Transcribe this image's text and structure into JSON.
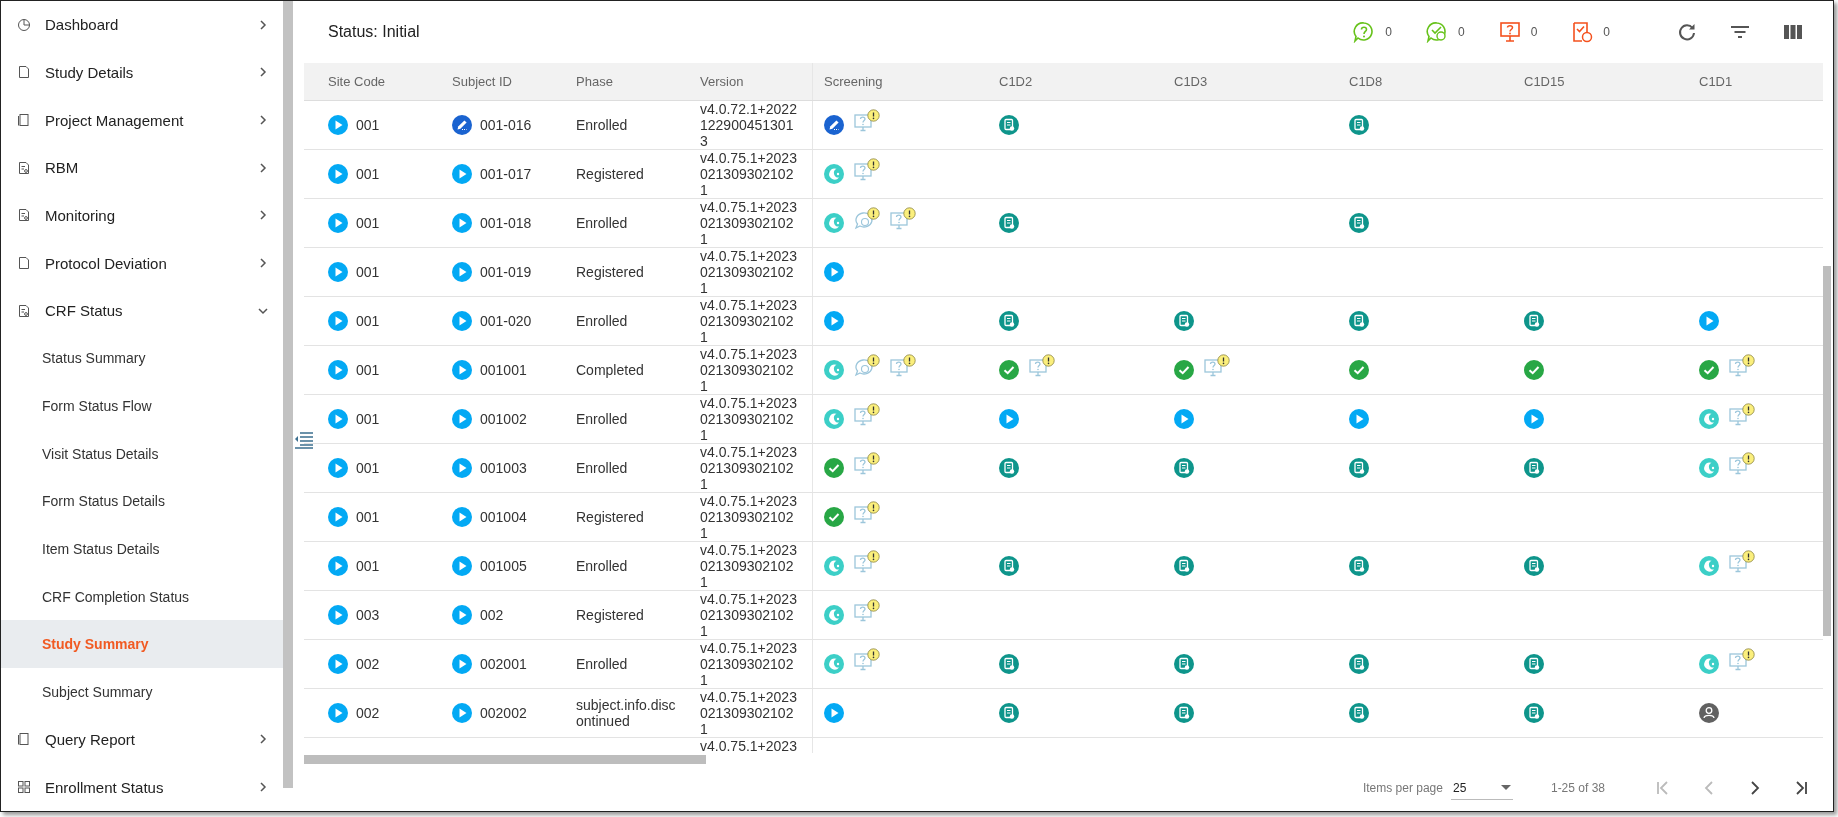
{
  "sidebar": {
    "items": [
      {
        "label": "Dashboard",
        "expanded": false
      },
      {
        "label": "Study Details",
        "expanded": false
      },
      {
        "label": "Project Management",
        "expanded": false
      },
      {
        "label": "RBM",
        "expanded": false
      },
      {
        "label": "Monitoring",
        "expanded": false
      },
      {
        "label": "Protocol Deviation",
        "expanded": false
      },
      {
        "label": "CRF Status",
        "expanded": true,
        "children": [
          {
            "label": "Status Summary",
            "selected": false
          },
          {
            "label": "Form Status Flow",
            "selected": false
          },
          {
            "label": "Visit Status Details",
            "selected": false
          },
          {
            "label": "Form Status Details",
            "selected": false
          },
          {
            "label": "Item Status Details",
            "selected": false
          },
          {
            "label": "CRF Completion Status",
            "selected": false
          },
          {
            "label": "Study Summary",
            "selected": true
          },
          {
            "label": "Subject Summary",
            "selected": false
          }
        ]
      },
      {
        "label": "Query Report",
        "expanded": false
      },
      {
        "label": "Enrollment Status",
        "expanded": false
      }
    ]
  },
  "header": {
    "title": "Status: Initial",
    "counters": [
      {
        "count": "0"
      },
      {
        "count": "0"
      },
      {
        "count": "0"
      },
      {
        "count": "0"
      }
    ]
  },
  "table": {
    "columns": [
      "Site Code",
      "Subject ID",
      "Phase",
      "Version"
    ],
    "visit_columns": [
      "Screening",
      "C1D2",
      "C1D3",
      "C1D8",
      "C1D15",
      "C1D1"
    ],
    "rows": [
      {
        "site_code": "001",
        "site_icon": {
          "kind": "play"
        },
        "subject_id": "001-016",
        "subject_icon": {
          "kind": "edit"
        },
        "phase": "Enrolled",
        "version": "v4.0.72.1+20221229004513013",
        "visits": [
          [
            {
              "kind": "edit"
            },
            {
              "kind": "query"
            }
          ],
          [
            {
              "kind": "form"
            }
          ],
          [
            {
              "kind": "empty"
            }
          ],
          [
            {
              "kind": "form"
            }
          ]
        ]
      },
      {
        "site_code": "001",
        "site_icon": {
          "kind": "play"
        },
        "subject_id": "001-017",
        "subject_icon": {
          "kind": "play"
        },
        "phase": "Registered",
        "version": "v4.0.75.1+20230213093021021",
        "visits": [
          [
            {
              "kind": "partial"
            },
            {
              "kind": "query"
            }
          ]
        ]
      },
      {
        "site_code": "001",
        "site_icon": {
          "kind": "play"
        },
        "subject_id": "001-018",
        "subject_icon": {
          "kind": "play"
        },
        "phase": "Enrolled",
        "version": "v4.0.75.1+20230213093021021",
        "visits": [
          [
            {
              "kind": "partial"
            },
            {
              "kind": "comment"
            },
            {
              "kind": "query"
            }
          ],
          [
            {
              "kind": "form"
            }
          ],
          [
            {
              "kind": "empty"
            }
          ],
          [
            {
              "kind": "form"
            }
          ]
        ]
      },
      {
        "site_code": "001",
        "site_icon": {
          "kind": "play"
        },
        "subject_id": "001-019",
        "subject_icon": {
          "kind": "play"
        },
        "phase": "Registered",
        "version": "v4.0.75.1+20230213093021021",
        "visits": [
          [
            {
              "kind": "play"
            }
          ]
        ]
      },
      {
        "site_code": "001",
        "site_icon": {
          "kind": "play"
        },
        "subject_id": "001-020",
        "subject_icon": {
          "kind": "play"
        },
        "phase": "Enrolled",
        "version": "v4.0.75.1+20230213093021021",
        "visits": [
          [
            {
              "kind": "play"
            }
          ],
          [
            {
              "kind": "form"
            }
          ],
          [
            {
              "kind": "form"
            }
          ],
          [
            {
              "kind": "form"
            }
          ],
          [
            {
              "kind": "form"
            }
          ],
          [
            {
              "kind": "play"
            }
          ]
        ]
      },
      {
        "site_code": "001",
        "site_icon": {
          "kind": "play"
        },
        "subject_id": "001001",
        "subject_icon": {
          "kind": "play"
        },
        "phase": "Completed",
        "version": "v4.0.75.1+20230213093021021",
        "visits": [
          [
            {
              "kind": "partial"
            },
            {
              "kind": "comment"
            },
            {
              "kind": "query"
            }
          ],
          [
            {
              "kind": "done"
            },
            {
              "kind": "query"
            }
          ],
          [
            {
              "kind": "done"
            },
            {
              "kind": "query"
            }
          ],
          [
            {
              "kind": "done"
            }
          ],
          [
            {
              "kind": "done"
            }
          ],
          [
            {
              "kind": "done"
            },
            {
              "kind": "query"
            }
          ]
        ]
      },
      {
        "site_code": "001",
        "site_icon": {
          "kind": "play"
        },
        "subject_id": "001002",
        "subject_icon": {
          "kind": "play"
        },
        "phase": "Enrolled",
        "version": "v4.0.75.1+20230213093021021",
        "visits": [
          [
            {
              "kind": "partial"
            },
            {
              "kind": "query"
            }
          ],
          [
            {
              "kind": "play"
            }
          ],
          [
            {
              "kind": "play"
            }
          ],
          [
            {
              "kind": "play"
            }
          ],
          [
            {
              "kind": "play"
            }
          ],
          [
            {
              "kind": "partial"
            },
            {
              "kind": "query"
            }
          ]
        ]
      },
      {
        "site_code": "001",
        "site_icon": {
          "kind": "play"
        },
        "subject_id": "001003",
        "subject_icon": {
          "kind": "play"
        },
        "phase": "Enrolled",
        "version": "v4.0.75.1+20230213093021021",
        "visits": [
          [
            {
              "kind": "done"
            },
            {
              "kind": "query"
            }
          ],
          [
            {
              "kind": "form"
            }
          ],
          [
            {
              "kind": "form"
            }
          ],
          [
            {
              "kind": "form"
            }
          ],
          [
            {
              "kind": "form"
            }
          ],
          [
            {
              "kind": "partial"
            },
            {
              "kind": "query"
            }
          ]
        ]
      },
      {
        "site_code": "001",
        "site_icon": {
          "kind": "play"
        },
        "subject_id": "001004",
        "subject_icon": {
          "kind": "play"
        },
        "phase": "Registered",
        "version": "v4.0.75.1+20230213093021021",
        "visits": [
          [
            {
              "kind": "done"
            },
            {
              "kind": "query"
            }
          ]
        ]
      },
      {
        "site_code": "001",
        "site_icon": {
          "kind": "play"
        },
        "subject_id": "001005",
        "subject_icon": {
          "kind": "play"
        },
        "phase": "Enrolled",
        "version": "v4.0.75.1+20230213093021021",
        "visits": [
          [
            {
              "kind": "partial"
            },
            {
              "kind": "query"
            }
          ],
          [
            {
              "kind": "form"
            }
          ],
          [
            {
              "kind": "form"
            }
          ],
          [
            {
              "kind": "form"
            }
          ],
          [
            {
              "kind": "form"
            }
          ],
          [
            {
              "kind": "partial"
            },
            {
              "kind": "query"
            }
          ]
        ]
      },
      {
        "site_code": "003",
        "site_icon": {
          "kind": "play"
        },
        "subject_id": "002",
        "subject_icon": {
          "kind": "play"
        },
        "phase": "Registered",
        "version": "v4.0.75.1+20230213093021021",
        "visits": [
          [
            {
              "kind": "partial"
            },
            {
              "kind": "query"
            }
          ]
        ]
      },
      {
        "site_code": "002",
        "site_icon": {
          "kind": "play"
        },
        "subject_id": "002001",
        "subject_icon": {
          "kind": "play"
        },
        "phase": "Enrolled",
        "version": "v4.0.75.1+20230213093021021",
        "visits": [
          [
            {
              "kind": "partial"
            },
            {
              "kind": "query"
            }
          ],
          [
            {
              "kind": "form"
            }
          ],
          [
            {
              "kind": "form"
            }
          ],
          [
            {
              "kind": "form"
            }
          ],
          [
            {
              "kind": "form"
            }
          ],
          [
            {
              "kind": "partial"
            },
            {
              "kind": "query"
            }
          ]
        ]
      },
      {
        "site_code": "002",
        "site_icon": {
          "kind": "play"
        },
        "subject_id": "002002",
        "subject_icon": {
          "kind": "play"
        },
        "phase": "subject.info.discontinued",
        "version": "v4.0.75.1+20230213093021021",
        "visits": [
          [
            {
              "kind": "play"
            }
          ],
          [
            {
              "kind": "form"
            }
          ],
          [
            {
              "kind": "form"
            }
          ],
          [
            {
              "kind": "form"
            }
          ],
          [
            {
              "kind": "form"
            }
          ],
          [
            {
              "kind": "user"
            }
          ]
        ]
      },
      {
        "version": "v4.0.75.1+2023"
      }
    ]
  },
  "pagination": {
    "items_per_page_label": "Items per page",
    "page_size": "25",
    "range": "1-25 of 38",
    "buttons": [
      {
        "kind": "first",
        "disabled": true
      },
      {
        "kind": "prev",
        "disabled": true
      },
      {
        "kind": "next",
        "disabled": false
      },
      {
        "kind": "last",
        "disabled": false
      }
    ]
  }
}
